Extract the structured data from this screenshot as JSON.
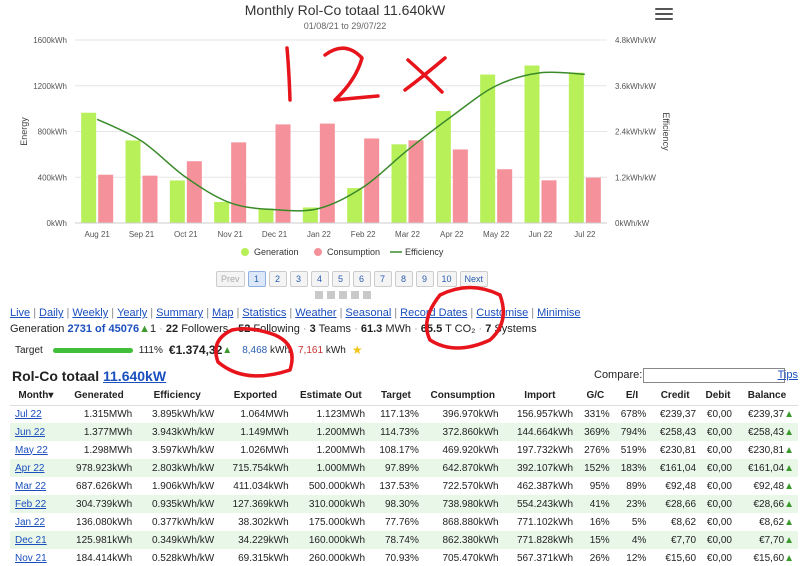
{
  "chart_data": {
    "type": "bar",
    "title": "Monthly Rol-Co totaal 11.640kW",
    "subtitle": "01/08/21 to 29/07/22",
    "categories": [
      "Aug 21",
      "Sep 21",
      "Oct 21",
      "Nov 21",
      "Dec 21",
      "Jan 22",
      "Feb 22",
      "Mar 22",
      "Apr 22",
      "May 22",
      "Jun 22",
      "Jul 22"
    ],
    "series": [
      {
        "name": "Generation",
        "color": "#b8f05a",
        "axis": "left",
        "values": [
          964,
          722,
          372,
          184,
          126,
          136,
          305,
          688,
          979,
          1298,
          1377,
          1315
        ]
      },
      {
        "name": "Consumption",
        "color": "#f4919a",
        "axis": "left",
        "values": [
          422,
          414,
          540,
          705,
          862,
          869,
          739,
          723,
          643,
          470,
          373,
          397
        ]
      },
      {
        "name": "Efficiency",
        "color": "#3a8a2a",
        "type": "line",
        "axis": "right",
        "values": [
          2.72,
          2.15,
          1.2,
          0.53,
          0.35,
          0.38,
          0.94,
          1.91,
          2.8,
          3.6,
          3.94,
          3.9
        ]
      }
    ],
    "ylabel": "Energy",
    "ylabel_right": "Efficiency",
    "ylim": [
      0,
      1600
    ],
    "ylim_right": [
      0,
      4.8
    ],
    "yticks": [
      "0kWh",
      "400kWh",
      "800kWh",
      "1200kWh",
      "1600kWh"
    ],
    "yticks_right": [
      "0kWh/kW",
      "1.2kWh/kW",
      "2.4kWh/kW",
      "3.6kWh/kW",
      "4.8kWh/kW"
    ],
    "grid": true,
    "legend_placement": "bottom"
  },
  "pager": {
    "prev": "Prev",
    "pages": [
      "1",
      "2",
      "3",
      "4",
      "5",
      "6",
      "7",
      "8",
      "9",
      "10"
    ],
    "current": "1",
    "next": "Next"
  },
  "nav": [
    "Live",
    "Daily",
    "Weekly",
    "Yearly",
    "Summary",
    "Map",
    "Statistics",
    "Weather",
    "Seasonal",
    "Record Dates",
    "Customise",
    "Minimise"
  ],
  "stats": {
    "generation_label": "Generation",
    "rank": "2731",
    "rank_of": "of 45076",
    "rank_change": "1",
    "followers_count": "22",
    "followers_label": "Followers",
    "following_count": "52",
    "following_label": "Following",
    "teams_count": "3",
    "teams_label": "Teams",
    "mwh_value": "61.3",
    "mwh_unit": "MWh",
    "co2_value": "65.5",
    "co2_unit": "T CO₂",
    "systems_count": "7",
    "systems_label": "Systems"
  },
  "target": {
    "label": "Target",
    "percent": "111%",
    "money": "€1.374,32",
    "blue_value": "8,468",
    "unit": "kWh",
    "red_value": "7,161",
    "unit2": "kWh"
  },
  "table": {
    "system_label": "Rol-Co totaal",
    "system_link": "11.640kW",
    "compare_label": "Compare:",
    "tips": "Tips",
    "headers": [
      "Month▾",
      "Generated",
      "Efficiency",
      "Exported",
      "Estimate Out",
      "Target",
      "Consumption",
      "Import",
      "G/C",
      "E/I",
      "Credit",
      "Debit",
      "Balance"
    ],
    "rows": [
      [
        "Jul 22",
        "1.315MWh",
        "3.895kWh/kW",
        "1.064MWh",
        "1.123MWh",
        "117.13%",
        "396.970kWh",
        "156.957kWh",
        "331%",
        "678%",
        "€239,37",
        "€0,00",
        "€239,37"
      ],
      [
        "Jun 22",
        "1.377MWh",
        "3.943kWh/kW",
        "1.149MWh",
        "1.200MWh",
        "114.73%",
        "372.860kWh",
        "144.664kWh",
        "369%",
        "794%",
        "€258,43",
        "€0,00",
        "€258,43"
      ],
      [
        "May 22",
        "1.298MWh",
        "3.597kWh/kW",
        "1.026MWh",
        "1.200MWh",
        "108.17%",
        "469.920kWh",
        "197.732kWh",
        "276%",
        "519%",
        "€230,81",
        "€0,00",
        "€230,81"
      ],
      [
        "Apr 22",
        "978.923kWh",
        "2.803kWh/kW",
        "715.754kWh",
        "1.000MWh",
        "97.89%",
        "642.870kWh",
        "392.107kWh",
        "152%",
        "183%",
        "€161,04",
        "€0,00",
        "€161,04"
      ],
      [
        "Mar 22",
        "687.626kWh",
        "1.906kWh/kW",
        "411.034kWh",
        "500.000kWh",
        "137.53%",
        "722.570kWh",
        "462.387kWh",
        "95%",
        "89%",
        "€92,48",
        "€0,00",
        "€92,48"
      ],
      [
        "Feb 22",
        "304.739kWh",
        "0.935kWh/kW",
        "127.369kWh",
        "310.000kWh",
        "98.30%",
        "738.980kWh",
        "554.243kWh",
        "41%",
        "23%",
        "€28,66",
        "€0,00",
        "€28,66"
      ],
      [
        "Jan 22",
        "136.080kWh",
        "0.377kWh/kW",
        "38.302kWh",
        "175.000kWh",
        "77.76%",
        "868.880kWh",
        "771.102kWh",
        "16%",
        "5%",
        "€8,62",
        "€0,00",
        "€8,62"
      ],
      [
        "Dec 21",
        "125.981kWh",
        "0.349kWh/kW",
        "34.229kWh",
        "160.000kWh",
        "78.74%",
        "862.380kWh",
        "771.828kWh",
        "15%",
        "4%",
        "€7,70",
        "€0,00",
        "€7,70"
      ],
      [
        "Nov 21",
        "184.414kWh",
        "0.528kWh/kW",
        "69.315kWh",
        "260.000kWh",
        "70.93%",
        "705.470kWh",
        "567.371kWh",
        "26%",
        "12%",
        "€15,60",
        "€0,00",
        "€15,60"
      ]
    ]
  },
  "annotations": {
    "handwritten": "12x"
  }
}
